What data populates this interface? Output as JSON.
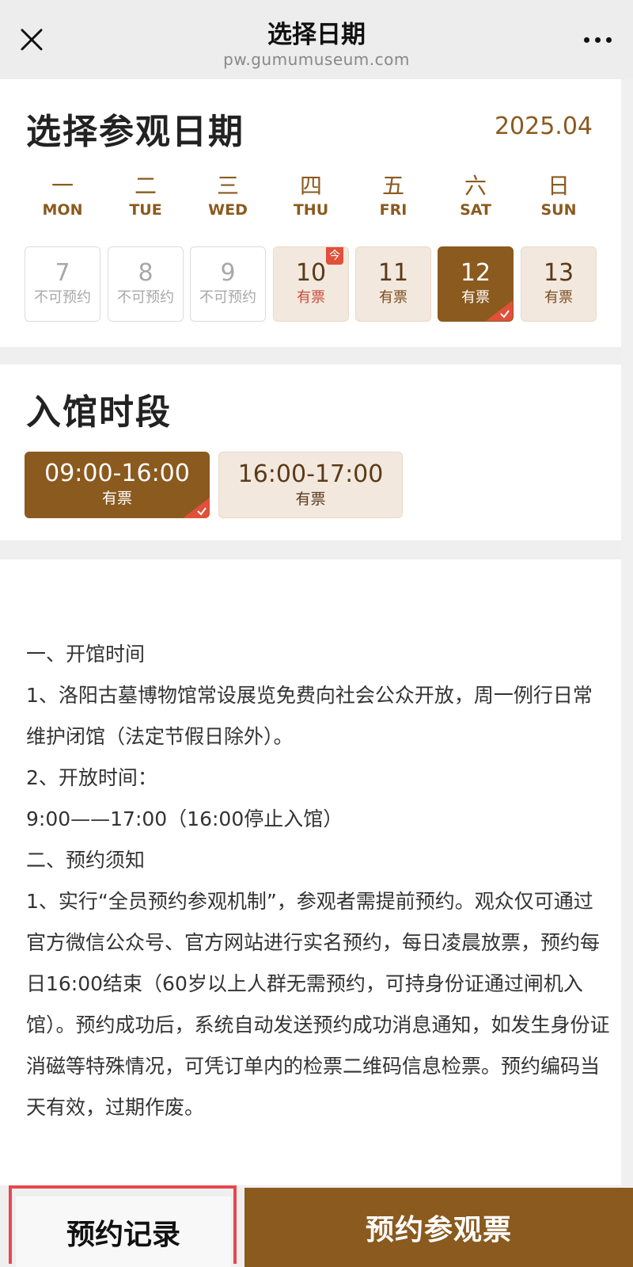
{
  "header": {
    "title": "选择日期",
    "domain": "pw.gumumuseum.com"
  },
  "date_section": {
    "title": "选择参观日期",
    "month": "2025.04",
    "weekdays": [
      {
        "cn": "一",
        "en": "MON"
      },
      {
        "cn": "二",
        "en": "TUE"
      },
      {
        "cn": "三",
        "en": "WED"
      },
      {
        "cn": "四",
        "en": "THU"
      },
      {
        "cn": "五",
        "en": "FRI"
      },
      {
        "cn": "六",
        "en": "SAT"
      },
      {
        "cn": "日",
        "en": "SUN"
      }
    ],
    "today_tag": "今",
    "days": [
      {
        "num": "7",
        "status": "不可预约",
        "state": "unavailable"
      },
      {
        "num": "8",
        "status": "不可预约",
        "state": "unavailable"
      },
      {
        "num": "9",
        "status": "不可预约",
        "state": "unavailable"
      },
      {
        "num": "10",
        "status": "有票",
        "state": "today"
      },
      {
        "num": "11",
        "status": "有票",
        "state": "available"
      },
      {
        "num": "12",
        "status": "有票",
        "state": "selected"
      },
      {
        "num": "13",
        "status": "有票",
        "state": "available"
      }
    ]
  },
  "time_section": {
    "title": "入馆时段",
    "slots": [
      {
        "range": "09:00-16:00",
        "status": "有票",
        "state": "selected"
      },
      {
        "range": "16:00-17:00",
        "status": "有票",
        "state": "available"
      }
    ]
  },
  "notice": {
    "lines": [
      "一、开馆时间",
      "1、洛阳古墓博物馆常设展览免费向社会公众开放，周一例行日常维护闭馆（法定节假日除外）。",
      "2、开放时间：",
      "9:00——17:00（16:00停止入馆）",
      "二、预约须知",
      "1、实行“全员预约参观机制”，参观者需提前预约。观众仅可通过官方微信公众号、官方网站进行实名预约，每日凌晨放票，预约每日16:00结束（60岁以上人群无需预约，可持身份证通过闸机入馆）。预约成功后，系统自动发送预约成功消息通知，如发生身份证消磁等特殊情况，可凭订单内的检票二维码信息检票。预约编码当天有效，过期作废。"
    ]
  },
  "footer": {
    "records_label": "预约记录",
    "book_label": "预约参观票"
  },
  "colors": {
    "brand_brown": "#8b5a1f",
    "available_bg": "#f3e8dd",
    "accent_red": "#e0503a",
    "highlight_red": "#e8474f"
  },
  "icons": [
    "close-icon",
    "more-dots-icon",
    "check-icon"
  ]
}
